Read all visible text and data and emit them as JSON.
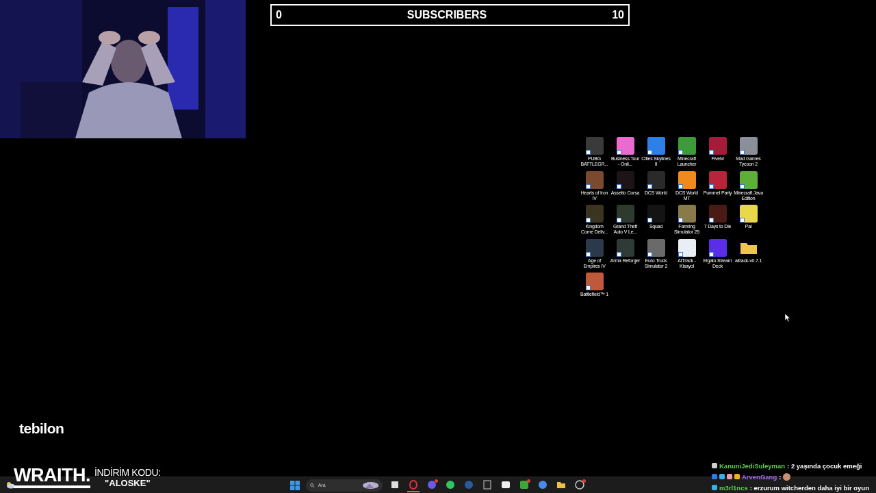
{
  "subscriber_goal": {
    "current": "0",
    "label": "SUBSCRIBERS",
    "target": "10",
    "level": 0
  },
  "desktop_icons": [
    {
      "label": "PUBG BATTLEGR...",
      "kind": "app",
      "color": "#3a3a3a"
    },
    {
      "label": "Business Tour - Onli...",
      "kind": "app",
      "color": "#e86bd0"
    },
    {
      "label": "Cities Skylines II",
      "kind": "app",
      "color": "#2f7fe8"
    },
    {
      "label": "Minecraft Launcher",
      "kind": "app",
      "color": "#3e9b3a"
    },
    {
      "label": "FiveM",
      "kind": "app",
      "color": "#a31c3a"
    },
    {
      "label": "Mad Games Tycoon 2",
      "kind": "app",
      "color": "#8a8f99"
    },
    {
      "label": "Hearts of Iron IV",
      "kind": "app",
      "color": "#7a4a2e"
    },
    {
      "label": "Assetto Corsa",
      "kind": "app",
      "color": "#1c1416"
    },
    {
      "label": "DCS World",
      "kind": "app",
      "color": "#2a2a2a"
    },
    {
      "label": "DCS World MT",
      "kind": "app",
      "color": "#f08a1c"
    },
    {
      "label": "Pummel Party",
      "kind": "app",
      "color": "#b8243a"
    },
    {
      "label": "Minecraft Java Edition",
      "kind": "app",
      "color": "#5fae3a"
    },
    {
      "label": "Kingdom Come Deliv...",
      "kind": "app",
      "color": "#3a3420"
    },
    {
      "label": "Grand Theft Auto V Le...",
      "kind": "app",
      "color": "#2e3a2e"
    },
    {
      "label": "Squad",
      "kind": "app",
      "color": "#141414"
    },
    {
      "label": "Farming Simulator 25",
      "kind": "app",
      "color": "#8a7a4a"
    },
    {
      "label": "7 Days to Die",
      "kind": "app",
      "color": "#4a1a14"
    },
    {
      "label": "Pal",
      "kind": "app",
      "color": "#e8d84a"
    },
    {
      "label": "Age of Empires IV",
      "kind": "app",
      "color": "#2a3a4a"
    },
    {
      "label": "Arma Reforger",
      "kind": "app",
      "color": "#2e3a36"
    },
    {
      "label": "Euro Truck Simulator 2",
      "kind": "app",
      "color": "#6a6a6a"
    },
    {
      "label": "AITrack - Kisayol",
      "kind": "app",
      "color": "#e8eef4"
    },
    {
      "label": "Elgato Stream Deck",
      "kind": "app",
      "color": "#5a2ee8"
    },
    {
      "label": "aitrack-v0.7.1",
      "kind": "folder",
      "color": "#f0c64a"
    },
    {
      "label": "Battlefield™ 1",
      "kind": "app",
      "color": "#c0583a"
    }
  ],
  "sponsor_logo": "tebilon",
  "promo": {
    "brand": "WRAITH.",
    "caption": "İNDİRİM KODU:",
    "code": "\"ALOSKE\""
  },
  "taskbar": {
    "search": {
      "placeholder": "Ara"
    },
    "apps": [
      {
        "kind": "task-view",
        "active": false,
        "notification": false
      },
      {
        "kind": "browser",
        "active": true,
        "notification": false
      },
      {
        "kind": "chat",
        "active": false,
        "notification": true
      },
      {
        "kind": "music",
        "active": false,
        "notification": false
      },
      {
        "kind": "steam",
        "active": false,
        "notification": false
      },
      {
        "kind": "store",
        "active": false,
        "notification": false
      },
      {
        "kind": "capture",
        "active": false,
        "notification": false
      },
      {
        "kind": "xbox",
        "active": false,
        "notification": true
      },
      {
        "kind": "copilot",
        "active": false,
        "notification": false
      },
      {
        "kind": "folder",
        "active": false,
        "notification": false
      },
      {
        "kind": "tool",
        "active": false,
        "notification": true
      }
    ]
  },
  "chat": [
    {
      "user": "KanuniJediSuleyman",
      "color": "#5ad04a",
      "text": ": 2 yaşında çocuk emeği",
      "badges": [
        {
          "color": "#cfcfcf"
        }
      ]
    },
    {
      "user": "ArvenGang",
      "color": "#a06ae8",
      "text": ":",
      "emote": true,
      "badges": [
        {
          "color": "#2a7ae8"
        },
        {
          "color": "#3ab0e8"
        },
        {
          "color": "#e8a0b0"
        },
        {
          "color": "#f0b020"
        }
      ]
    },
    {
      "user": "m3rl1ncs",
      "color": "#5ad04a",
      "text": ": erzurum witcherden daha iyi bir oyun",
      "badges": [
        {
          "color": "#3ab0e8"
        }
      ]
    }
  ]
}
